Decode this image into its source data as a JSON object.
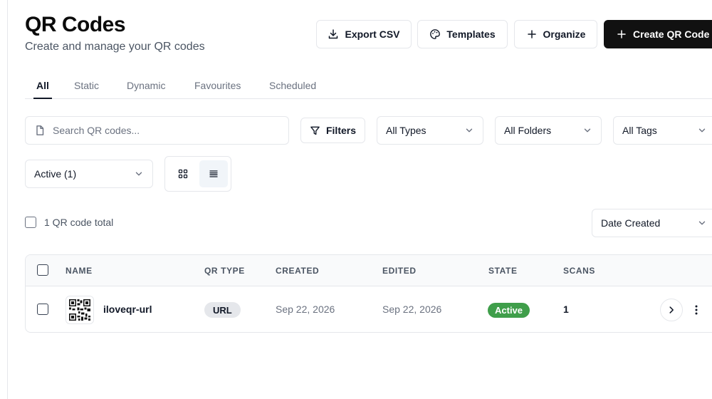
{
  "header": {
    "title": "QR Codes",
    "subtitle": "Create and manage your QR codes"
  },
  "actions": {
    "export_label": "Export CSV",
    "templates_label": "Templates",
    "organize_label": "Organize",
    "create_label": "Create QR Code"
  },
  "tabs": [
    {
      "label": "All",
      "active": true
    },
    {
      "label": "Static",
      "active": false
    },
    {
      "label": "Dynamic",
      "active": false
    },
    {
      "label": "Favourites",
      "active": false
    },
    {
      "label": "Scheduled",
      "active": false
    }
  ],
  "toolbar": {
    "search_placeholder": "Search QR codes...",
    "search_value": "",
    "filters_label": "Filters",
    "type_select": "All Types",
    "folder_select": "All Folders",
    "tag_select": "All Tags",
    "status_select": "Active (1)",
    "view_mode": "list"
  },
  "summary": {
    "total_label": "1 QR code total",
    "sort_select": "Date Created"
  },
  "table": {
    "columns": [
      "NAME",
      "QR TYPE",
      "CREATED",
      "EDITED",
      "STATE",
      "SCANS"
    ],
    "rows": [
      {
        "name": "iloveqr-url",
        "qr_type": "URL",
        "created": "Sep 22, 2026",
        "edited": "Sep 22, 2026",
        "state": "Active",
        "scans": "1"
      }
    ]
  },
  "colors": {
    "primary_button": "#111111",
    "active_state": "#3f9e4a",
    "border": "#e5e7eb",
    "muted_text": "#6b7280"
  },
  "icons": [
    "download-icon",
    "palette-icon",
    "plus-icon",
    "file-icon",
    "filter-icon",
    "chevron-down-icon",
    "grid-view-icon",
    "list-view-icon",
    "qr-code-icon",
    "chevron-right-icon",
    "more-vertical-icon"
  ]
}
